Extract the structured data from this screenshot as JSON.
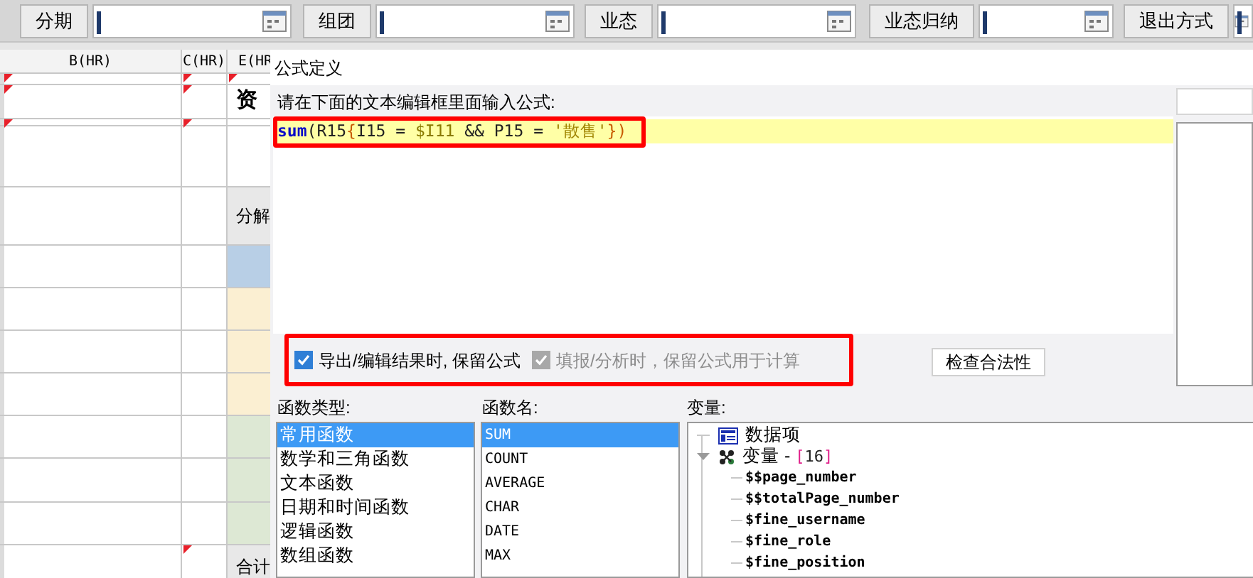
{
  "toolbar": {
    "filters": [
      {
        "label": "分期"
      },
      {
        "label": "组团"
      },
      {
        "label": "业态"
      },
      {
        "label": "业态归纳"
      },
      {
        "label": "退出方式"
      }
    ]
  },
  "sheet": {
    "columns": [
      "B(HR)",
      "C(HR)",
      "E(HR"
    ],
    "rows": [
      {
        "text": ""
      },
      {
        "text": "资",
        "kind": "title"
      },
      {
        "text": ""
      },
      {
        "text": ""
      },
      {
        "text": "分解",
        "kind": "header"
      },
      {
        "text": "",
        "color": "#b8cfe6"
      },
      {
        "text": "",
        "color": "#fbefd2"
      },
      {
        "text": "",
        "color": "#fbefd2"
      },
      {
        "text": "",
        "color": "#fbefd2"
      },
      {
        "text": "",
        "color": "#dde8d4"
      },
      {
        "text": "",
        "color": "#dde8d4"
      },
      {
        "text": "",
        "color": "#dde8d4"
      },
      {
        "text": "合计",
        "kind": "header"
      }
    ]
  },
  "dialog": {
    "title": "公式定义",
    "instruction": "请在下面的文本编辑框里面输入公式:",
    "formula": {
      "highlighted": true,
      "tokens": [
        {
          "text": "sum",
          "kind": "function"
        },
        {
          "text": "(",
          "kind": "plain"
        },
        {
          "text": "R15",
          "kind": "plain"
        },
        {
          "text": "{",
          "kind": "brace"
        },
        {
          "text": "I15 = ",
          "kind": "plain"
        },
        {
          "text": "$I11",
          "kind": "variable"
        },
        {
          "text": " && P15 = ",
          "kind": "plain"
        },
        {
          "text": "'散售'",
          "kind": "string"
        },
        {
          "text": "})",
          "kind": "brace"
        }
      ]
    },
    "options": {
      "highlighted": true,
      "checkboxes": [
        {
          "label": "导出/编辑结果时, 保留公式",
          "checked": true,
          "disabled": false
        },
        {
          "label": "填报/分析时，保留公式用于计算",
          "checked": true,
          "disabled": true
        }
      ]
    },
    "check_button": "检查合法性",
    "function_types": {
      "label": "函数类型:",
      "items": [
        {
          "label": "常用函数",
          "selected": true
        },
        {
          "label": "数学和三角函数",
          "selected": false
        },
        {
          "label": "文本函数",
          "selected": false
        },
        {
          "label": "日期和时间函数",
          "selected": false
        },
        {
          "label": "逻辑函数",
          "selected": false
        },
        {
          "label": "数组函数",
          "selected": false
        }
      ]
    },
    "function_names": {
      "label": "函数名:",
      "items": [
        {
          "label": "SUM",
          "selected": true
        },
        {
          "label": "COUNT",
          "selected": false
        },
        {
          "label": "AVERAGE",
          "selected": false
        },
        {
          "label": "CHAR",
          "selected": false
        },
        {
          "label": "DATE",
          "selected": false
        },
        {
          "label": "MAX",
          "selected": false
        }
      ]
    },
    "variables": {
      "label": "变量:",
      "tree": [
        {
          "label": "数据项",
          "kind": "data"
        },
        {
          "label": "变量 - ",
          "count": [
            {
              "text": "[",
              "kind": "bracket"
            },
            {
              "text": "16",
              "kind": "number"
            },
            {
              "text": "]",
              "kind": "bracket"
            }
          ],
          "kind": "group",
          "expanded": true,
          "children": [
            {
              "label": "$$page_number"
            },
            {
              "label": "$$totalPage_number"
            },
            {
              "label": "$fine_username"
            },
            {
              "label": "$fine_role"
            },
            {
              "label": "$fine_position"
            }
          ]
        }
      ]
    }
  }
}
